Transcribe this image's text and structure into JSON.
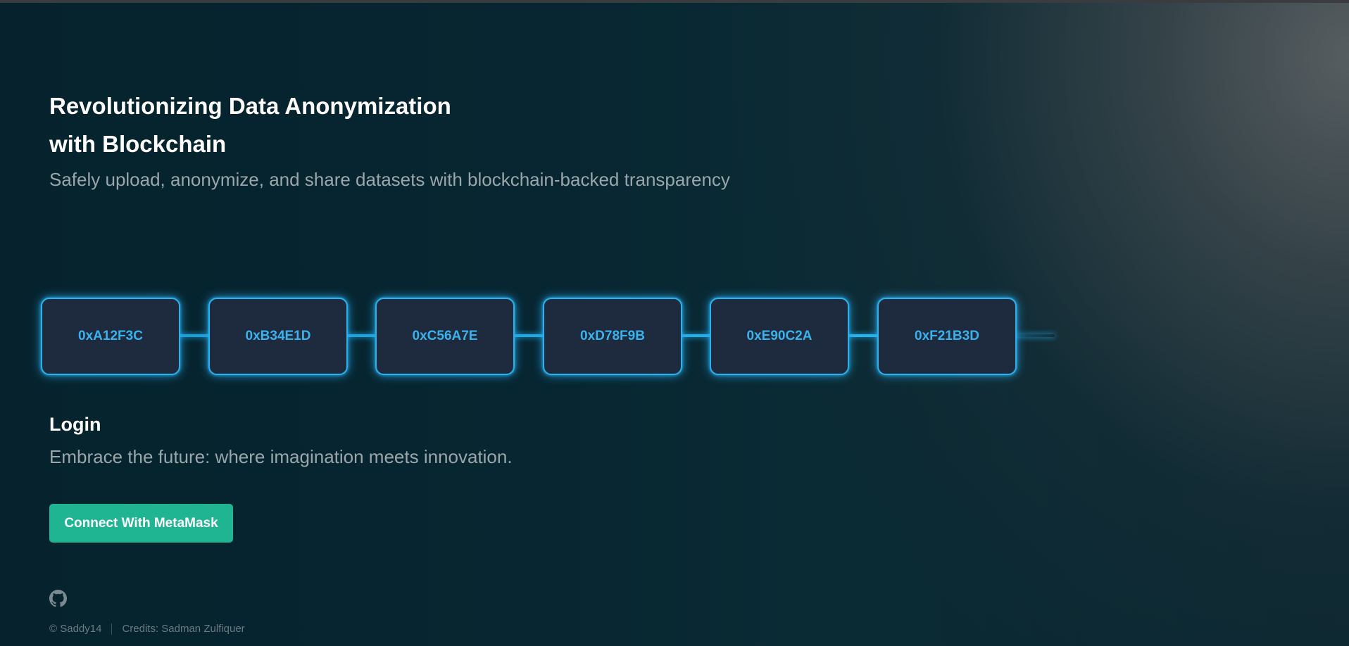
{
  "hero": {
    "title_line1": "Revolutionizing Data Anonymization",
    "title_line2": "with Blockchain",
    "subtitle": "Safely upload, anonymize, and share datasets with blockchain-backed transparency"
  },
  "chain": {
    "blocks": [
      "0xA12F3C",
      "0xB34E1D",
      "0xC56A7E",
      "0xD78F9B",
      "0xE90C2A",
      "0xF21B3D"
    ]
  },
  "login": {
    "heading": "Login",
    "tagline": "Embrace the future: where imagination meets innovation.",
    "connect_label": "Connect With MetaMask"
  },
  "footer": {
    "github_icon": "github-icon",
    "copyright": "© Saddy14",
    "credits": "Credits: Sadman Zulfiquer"
  },
  "colors": {
    "accent_block_text": "#3ab3ec",
    "block_border": "#2bb1ec",
    "block_fill": "#1e2a3e",
    "button": "#1fb593",
    "muted_text": "#9aa6aa"
  }
}
